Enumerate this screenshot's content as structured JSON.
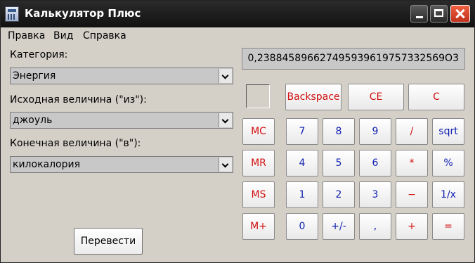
{
  "window": {
    "title": "Калькулятор Плюс"
  },
  "menu": {
    "items": [
      "Правка",
      "Вид",
      "Справка"
    ]
  },
  "converter": {
    "category_label": "Категория:",
    "category_value": "Энергия",
    "from_label": "Исходная величина (\"из\"):",
    "from_value": "джоуль",
    "to_label": "Конечная величина (\"в\"):",
    "to_value": "килокалория",
    "convert_button": "Перевести"
  },
  "calculator": {
    "display": "0,238845896627495939619757332569O3",
    "top_buttons": [
      "Backspace",
      "CE",
      "C"
    ],
    "memory_buttons": [
      "MC",
      "MR",
      "MS",
      "M+"
    ],
    "keypad": [
      [
        "7",
        "8",
        "9",
        "/",
        "sqrt"
      ],
      [
        "4",
        "5",
        "6",
        "*",
        "%"
      ],
      [
        "1",
        "2",
        "3",
        "−",
        "1/x"
      ],
      [
        "0",
        "+/-",
        ",",
        "+",
        "="
      ]
    ]
  }
}
